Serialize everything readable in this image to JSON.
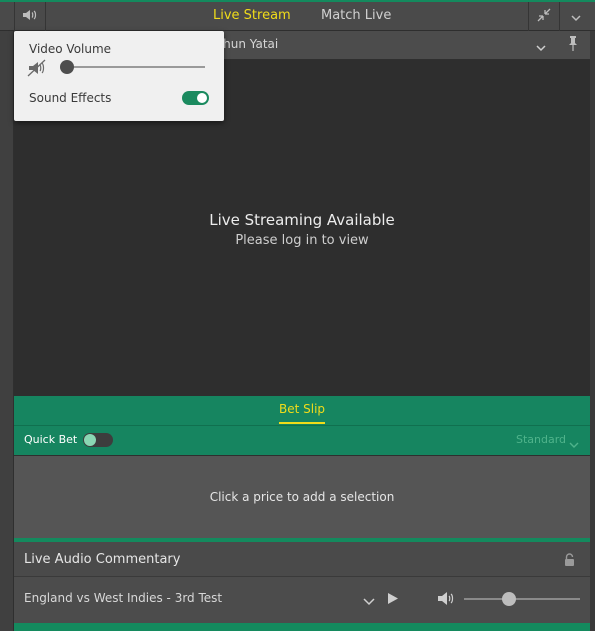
{
  "header": {
    "tabs": [
      {
        "label": "Live Stream",
        "active": true
      },
      {
        "label": "Match Live",
        "active": false
      }
    ],
    "accent_color": "#f0dc1a",
    "icons": [
      "speaker-icon",
      "minimize-icon",
      "chevron-down-icon"
    ]
  },
  "event_selector": {
    "event_name": "angchun Yatai",
    "icons": [
      "chevron-down-icon",
      "pin-icon"
    ]
  },
  "video": {
    "title": "Live Streaming Available",
    "subtitle": "Please log in to view"
  },
  "volume_popover": {
    "video_volume_label": "Video Volume",
    "video_volume_level": 0,
    "sound_effects_label": "Sound Effects",
    "sound_effects_on": true
  },
  "bet_slip": {
    "tab_label": "Bet Slip",
    "quick_bet_label": "Quick Bet",
    "quick_bet_on": false,
    "mode_label": "Standard",
    "empty_message": "Click a price to add a selection"
  },
  "commentary": {
    "title": "Live Audio Commentary",
    "match_name": "England vs West Indies - 3rd Test",
    "volume_level": 0.37
  },
  "colors": {
    "brand_green": "#168560",
    "dark_bg": "#2e2e2e",
    "highlight_yellow": "#f0dc1a"
  }
}
